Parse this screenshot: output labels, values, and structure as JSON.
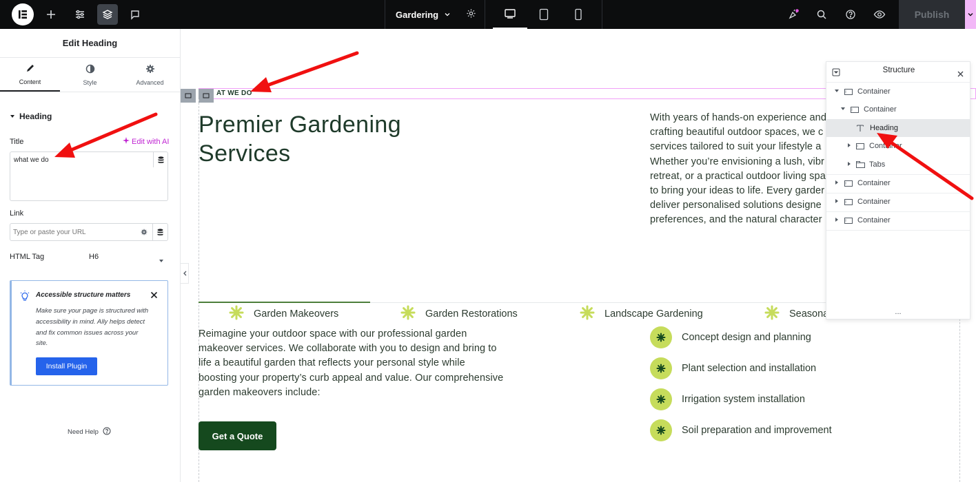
{
  "topbar": {
    "page_name": "Gardering",
    "publish_label": "Publish"
  },
  "panel": {
    "title": "Edit Heading",
    "tabs": [
      {
        "label": "Content",
        "icon": "pencil-icon"
      },
      {
        "label": "Style",
        "icon": "half-circle-icon"
      },
      {
        "label": "Advanced",
        "icon": "gear-icon"
      }
    ],
    "section_label": "Heading",
    "title_label": "Title",
    "edit_ai_label": "Edit with AI",
    "title_value": "what we do",
    "link_label": "Link",
    "link_placeholder": "Type or paste your URL",
    "html_tag_label": "HTML Tag",
    "html_tag_value": "H6",
    "notice": {
      "title": "Accessible structure matters",
      "body": "Make sure your page is structured with accessibility in mind. Ally helps detect and fix common issues across your site.",
      "button": "Install Plugin"
    },
    "help_label": "Need Help"
  },
  "canvas": {
    "eyebrow": "AT WE DO",
    "heading_line1": "Premier Gardening",
    "heading_line2": "Services",
    "intro_lines": [
      "With years of hands-on experience and",
      "crafting beautiful outdoor spaces, we c",
      "services tailored to suit your lifestyle a",
      "Whether you’re envisioning a lush, vibr",
      "retreat, or a practical outdoor living spa",
      "to bring your ideas to life. Every garder",
      "deliver personalised solutions designe",
      "preferences, and the natural character"
    ],
    "services": [
      "Garden Makeovers",
      "Garden Restorations",
      "Landscape Gardening",
      "Seasona"
    ],
    "makeover_lines": [
      "Reimagine your outdoor space with our professional garden",
      "makeover services. We collaborate with you to design and bring to",
      "life a beautiful garden that reflects your personal style while",
      "boosting your property’s curb appeal and value. Our comprehensive",
      "garden makeovers include:"
    ],
    "cta_label": "Get a Quote",
    "checklist": [
      "Concept design and planning",
      "Plant selection and installation",
      "Irrigation system installation",
      "Soil preparation and improvement"
    ]
  },
  "structure": {
    "title": "Structure",
    "items": [
      {
        "label": "Container"
      },
      {
        "label": "Container"
      },
      {
        "label": "Heading"
      },
      {
        "label": "Container"
      },
      {
        "label": "Tabs"
      },
      {
        "label": "Container"
      },
      {
        "label": "Container"
      },
      {
        "label": "Container"
      }
    ],
    "more": "..."
  },
  "colors": {
    "accent_green": "#c6dc5b",
    "dark_green": "#15491e",
    "heading_green": "#1e3a2a",
    "ai_magenta": "#c026d3",
    "arrow_red": "#f01010"
  }
}
